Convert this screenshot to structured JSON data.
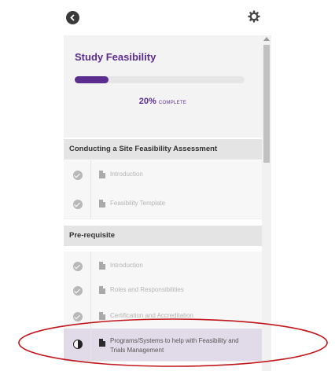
{
  "header": {
    "back_icon": "back-arrow-icon",
    "settings_icon": "gear-icon"
  },
  "summary": {
    "title": "Study Feasibility",
    "progress_percent_value": 20,
    "progress_percent": "20%",
    "progress_word": "COMPLETE",
    "accent_color": "#5b2d8e"
  },
  "sections": [
    {
      "title": "Conducting a Site Feasibility Assessment",
      "items": [
        {
          "label": "Introduction",
          "status": "complete",
          "icon": "document-icon"
        },
        {
          "label": "Feasibility Template",
          "status": "complete",
          "icon": "document-icon"
        }
      ]
    },
    {
      "title": "Pre-requisite",
      "items": [
        {
          "label": "Introduction",
          "status": "complete",
          "icon": "document-icon"
        },
        {
          "label": "Roles and Responsibilities",
          "status": "complete",
          "icon": "document-icon"
        },
        {
          "label": "Certification and Accreditation",
          "status": "complete",
          "icon": "document-icon"
        },
        {
          "label": "Programs/Systems to help with Feasibility and Trials Management",
          "status": "in-progress",
          "icon": "document-icon"
        }
      ]
    }
  ],
  "annotation_color": "#c0161c"
}
